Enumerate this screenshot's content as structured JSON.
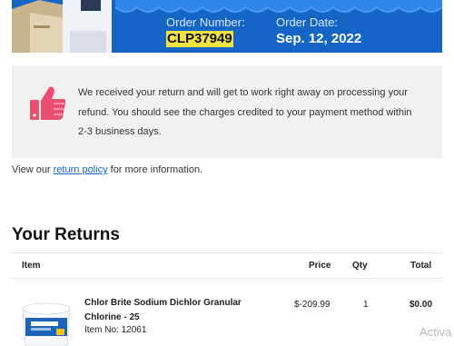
{
  "order": {
    "number_label": "Order Number:",
    "number": "CLP37949",
    "date_label": "Order Date:",
    "date": "Sep. 12, 2022"
  },
  "notice": {
    "icon": "thumbs-up-icon",
    "message": "We received your return and will get to work right away on processing your refund. You should see the charges credited to your payment method within 2-3 business days."
  },
  "policy": {
    "prefix": "View our ",
    "link_text": "return policy",
    "suffix": " for more information."
  },
  "returns": {
    "title": "Your Returns",
    "columns": {
      "item": "Item",
      "price": "Price",
      "qty": "Qty",
      "total": "Total"
    },
    "items": [
      {
        "name": "Chlor Brite Sodium Dichlor Granular Chlorine - 25",
        "item_no": "Item No: 12061",
        "price": "$-209.99",
        "qty": "1",
        "total": "$0.00"
      }
    ]
  },
  "watermark": "Activa",
  "colors": {
    "hero_blue": "#1565c7",
    "highlight": "#f5e342",
    "thumb_pink": "#ea4f6f",
    "link": "#1565c7"
  }
}
